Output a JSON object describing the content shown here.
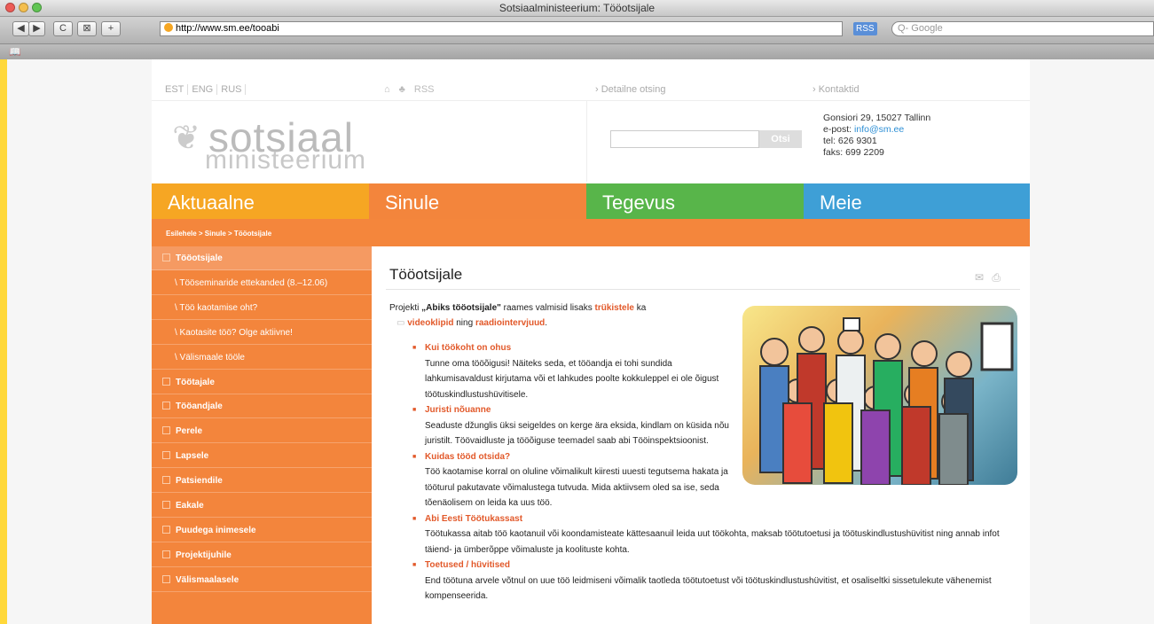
{
  "window": {
    "title": "Sotsiaalministeerium: Tööotsijale"
  },
  "toolbar": {
    "back": "◀",
    "forward": "▶",
    "reload": "C",
    "snap": "⊠",
    "add": "+",
    "url": "http://www.sm.ee/tooabi",
    "rss": "RSS",
    "search_placeholder": "Q- Google",
    "bookmark_icon": "📖"
  },
  "top": {
    "langs": [
      "EST",
      "ENG",
      "RUS"
    ],
    "icons": [
      "⌂",
      "♣",
      "RSS"
    ],
    "detailed_search": "› Detailne otsing",
    "contacts": "› Kontaktid"
  },
  "logo": {
    "top": "sotsiaal",
    "bottom": "ministeerium"
  },
  "search": {
    "button": "Otsi"
  },
  "contact": {
    "address": "Gonsiori 29, 15027 Tallinn",
    "email_label": "e-post: ",
    "email": "info@sm.ee",
    "tel": "tel: 626 9301",
    "fax": "faks: 699 2209"
  },
  "nav": [
    {
      "label": "Aktuaalne",
      "color": "#f6a623"
    },
    {
      "label": "Sinule",
      "color": "#f3853c"
    },
    {
      "label": "Tegevus",
      "color": "#58b54a"
    },
    {
      "label": "Meie",
      "color": "#3e9fd6"
    }
  ],
  "breadcrumb": "Esilehele > Sinule > Tööotsijale",
  "sidebar": [
    {
      "label": "Tööotsijale",
      "type": "active"
    },
    {
      "label": "\\ Tööseminaride ettekanded (8.–12.06)",
      "type": "sub"
    },
    {
      "label": "\\ Töö kaotamise oht?",
      "type": "sub"
    },
    {
      "label": "\\ Kaotasite töö? Olge aktiivne!",
      "type": "sub"
    },
    {
      "label": "\\ Välismaale tööle",
      "type": "sub"
    },
    {
      "label": "Töötajale",
      "type": "item"
    },
    {
      "label": "Tööandjale",
      "type": "item"
    },
    {
      "label": "Perele",
      "type": "item"
    },
    {
      "label": "Lapsele",
      "type": "item"
    },
    {
      "label": "Patsiendile",
      "type": "item"
    },
    {
      "label": "Eakale",
      "type": "item"
    },
    {
      "label": "Puudega inimesele",
      "type": "item"
    },
    {
      "label": "Projektijuhile",
      "type": "item"
    },
    {
      "label": "Välismaalasele",
      "type": "item"
    }
  ],
  "main": {
    "title": "Tööotsijale",
    "intro_1": "Projekti ",
    "intro_bold": "„Abiks tööotsijale\"",
    "intro_2": " raames valmisid lisaks ",
    "intro_link1": "trükistele",
    "intro_3": " ka",
    "intro_link2": "videoklipid",
    "intro_4": " ning ",
    "intro_link3": "raadiointervjuud",
    "intro_5": ".",
    "bullets": [
      {
        "heading": "Kui töökoht on ohus",
        "text": "Tunne oma tööõigusi! Näiteks seda, et tööandja ei tohi sundida lahkumisavaldust kirjutama või et lahkudes poolte kokkuleppel ei ole õigust töötuskindlustushüvitisele."
      },
      {
        "heading": "Juristi nõuanne",
        "text": "Seaduste džunglis üksi seigeldes on kerge ära eksida, kindlam on küsida nõu juristilt. Töövaidluste ja tööõiguse teemadel saab abi Tööinspektsioonist."
      },
      {
        "heading": "Kuidas tööd otsida?",
        "text": "Töö kaotamise korral on oluline võimalikult kiiresti uuesti tegutsema hakata ja tööturul pakutavate võimalustega tutvuda. Mida aktiivsem oled sa ise, seda tõenäolisem on leida ka uus töö."
      },
      {
        "heading": "Abi Eesti Töötukassast",
        "text": "Töötukassa aitab töö kaotanuil või koondamisteate kättesaanuil leida uut töökohta, maksab töötutoetusi ja töötuskindlustushüvitist ning annab infot täiend- ja ümberõppe võimaluste ja koolituste kohta."
      },
      {
        "heading": "Toetused / hüvitised",
        "text": "End töötuna arvele võtnul on uue töö leidmiseni võimalik taotleda töötutoetust või töötuskindlustushüvitist, et osaliseltki sissetulekute vähenemist kompenseerida."
      }
    ]
  }
}
